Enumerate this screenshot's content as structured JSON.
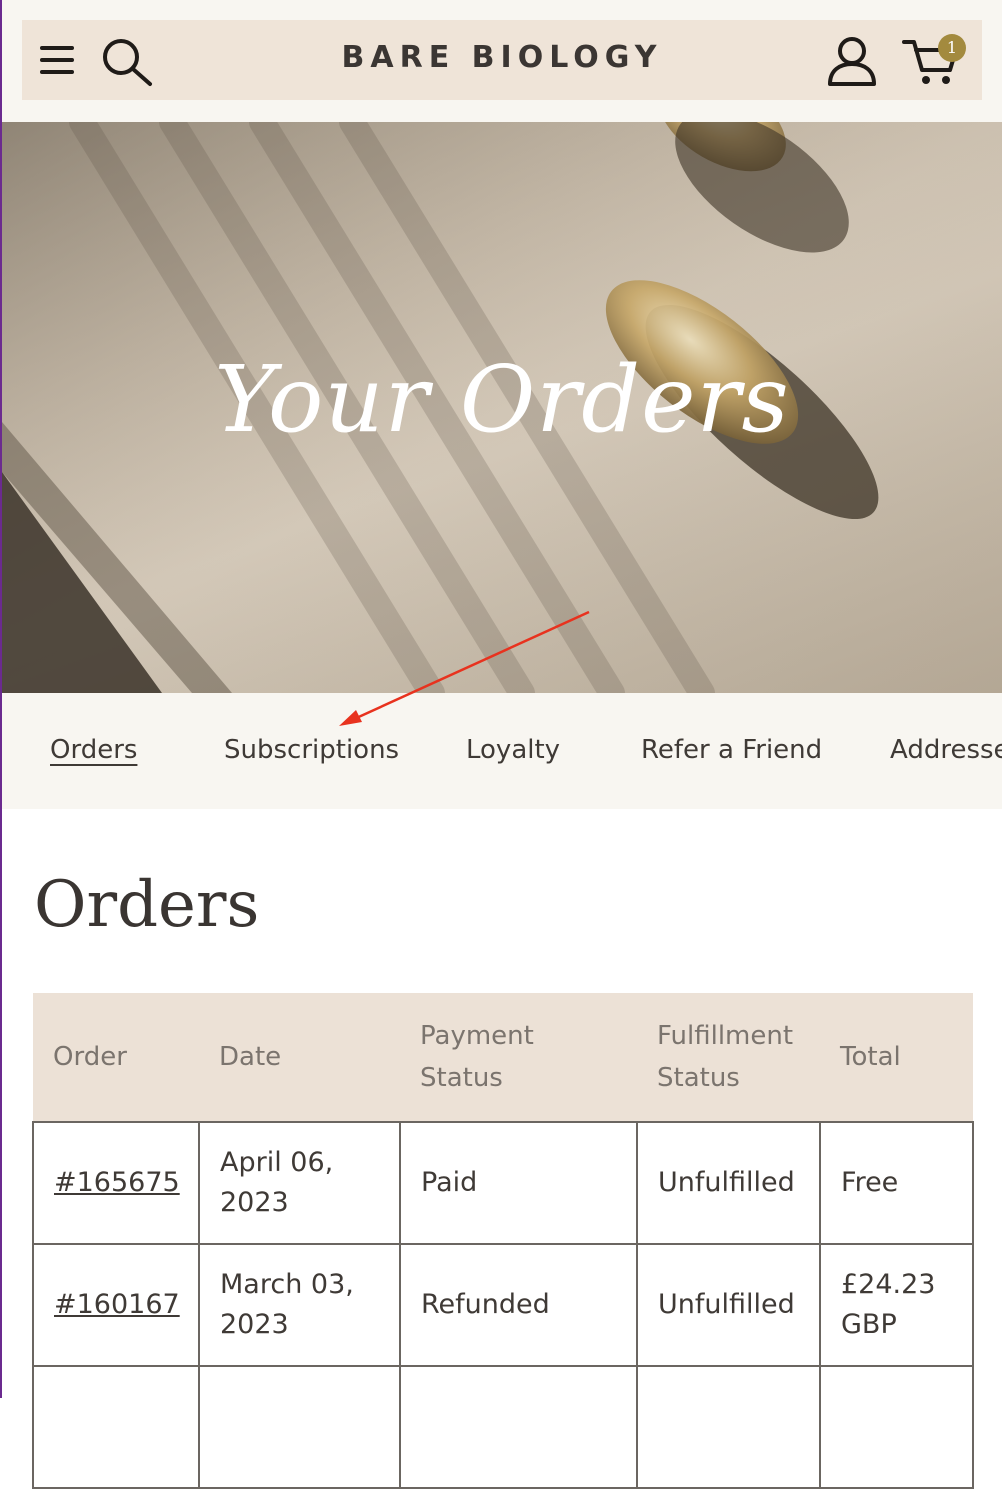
{
  "header": {
    "brand": "BARE BIOLOGY",
    "cart_count": "1",
    "icons": [
      "menu-icon",
      "search-icon",
      "account-icon",
      "cart-icon"
    ]
  },
  "hero": {
    "title": "Your Orders"
  },
  "tabs": [
    {
      "label": "Orders",
      "active": true
    },
    {
      "label": "Subscriptions"
    },
    {
      "label": "Loyalty"
    },
    {
      "label": "Refer a Friend"
    },
    {
      "label": "Addresses"
    }
  ],
  "orders": {
    "heading": "Orders",
    "columns": [
      "Order",
      "Date",
      "Payment Status",
      "Fulfillment Status",
      "Total"
    ],
    "rows": [
      {
        "order": "#165675",
        "date": "April 06, 2023",
        "payment": "Paid",
        "fulfillment": "Unfulfilled",
        "total": "Free"
      },
      {
        "order": "#160167",
        "date": "March 03, 2023",
        "payment": "Refunded",
        "fulfillment": "Unfulfilled",
        "total": "£24.23 GBP"
      },
      {
        "order": "",
        "date": "",
        "payment": "",
        "fulfillment": "",
        "total": ""
      }
    ]
  },
  "colors": {
    "header_bg": "#efe4d8",
    "page_band": "#f8f6f1",
    "table_header_bg": "#ece1d6",
    "badge": "#a38a3e",
    "annotation_arrow": "#e8321e"
  }
}
